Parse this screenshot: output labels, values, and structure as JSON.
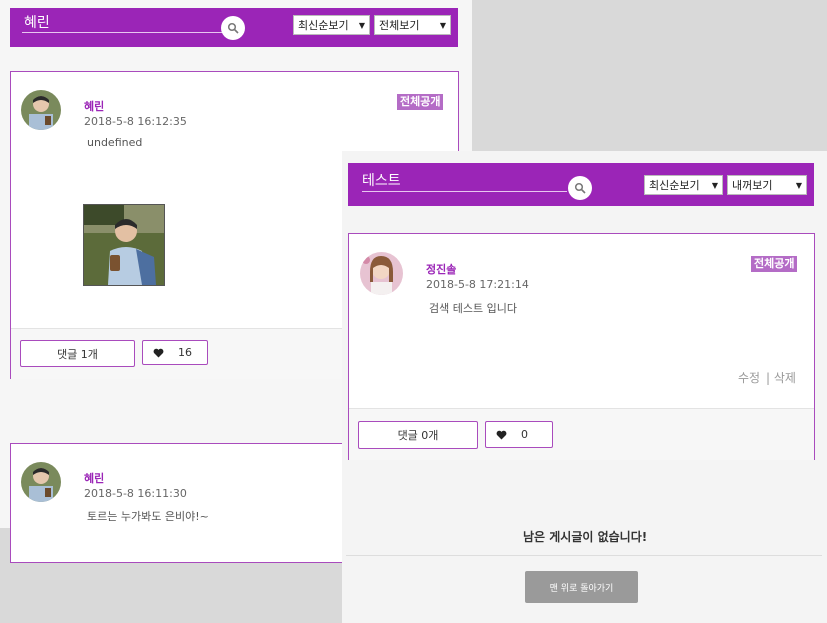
{
  "left_panel": {
    "search": {
      "query": "혜린"
    },
    "sort_select": {
      "value": "최신순보기"
    },
    "filter_select": {
      "value": "전체보기"
    },
    "posts": [
      {
        "author": "혜린",
        "date": "2018-5-8 16:12:35",
        "content": "undefined",
        "visibility": "전체공개",
        "comments_label": "댓글 1개",
        "likes": "16"
      },
      {
        "author": "혜린",
        "date": "2018-5-8 16:11:30",
        "content": "토르는 누가봐도 은비야!~"
      }
    ]
  },
  "right_panel": {
    "search": {
      "query": "테스트"
    },
    "sort_select": {
      "value": "최신순보기"
    },
    "filter_select": {
      "value": "내꺼보기"
    },
    "post": {
      "author": "정진솔",
      "date": "2018-5-8 17:21:14",
      "content": "검색 테스트 입니다",
      "visibility": "전체공개",
      "edit_label": "수정",
      "delete_label": "| 삭제",
      "comments_label": "댓글 0개",
      "likes": "0"
    },
    "end_message": "남은 게시글이 없습니다!",
    "back_to_top_label": "맨 위로 돌아가기"
  },
  "colors": {
    "accent": "#9b25b7",
    "badge": "#b46cc6",
    "border": "#a94bbd"
  },
  "icons": [
    "search-icon",
    "heart-icon",
    "dropdown-arrow-icon"
  ]
}
